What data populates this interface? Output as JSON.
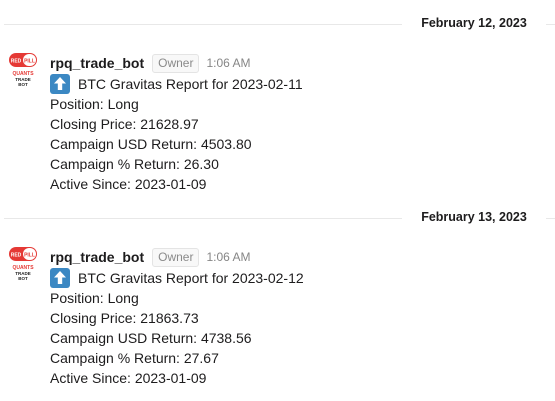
{
  "messages": [
    {
      "date": "February 12, 2023",
      "sender": "rpq_trade_bot",
      "badge": "Owner",
      "time": "1:06 AM",
      "emoji": "up-arrow-icon",
      "report_title": "BTC Gravitas Report for 2023-02-11",
      "position": "Position: Long",
      "closing_price": "Closing Price: 21628.97",
      "usd_return": "Campaign USD Return: 4503.80",
      "pct_return": "Campaign % Return: 26.30",
      "active_since": "Active Since: 2023-01-09"
    },
    {
      "date": "February 13, 2023",
      "sender": "rpq_trade_bot",
      "badge": "Owner",
      "time": "1:06 AM",
      "emoji": "up-arrow-icon",
      "report_title": "BTC Gravitas Report for 2023-02-12",
      "position": "Position: Long",
      "closing_price": "Closing Price: 21863.73",
      "usd_return": "Campaign USD Return: 4738.56",
      "pct_return": "Campaign % Return: 27.67",
      "active_since": "Active Since: 2023-01-09"
    }
  ],
  "avatar_logo": {
    "top_text": "RED PILL",
    "middle_text": "QUANTS",
    "bottom_text": "TRADE BOT"
  },
  "colors": {
    "text": "#1d1c1d",
    "muted": "#868686",
    "emoji_blue": "#3b88c3",
    "avatar_red": "#e53935"
  }
}
